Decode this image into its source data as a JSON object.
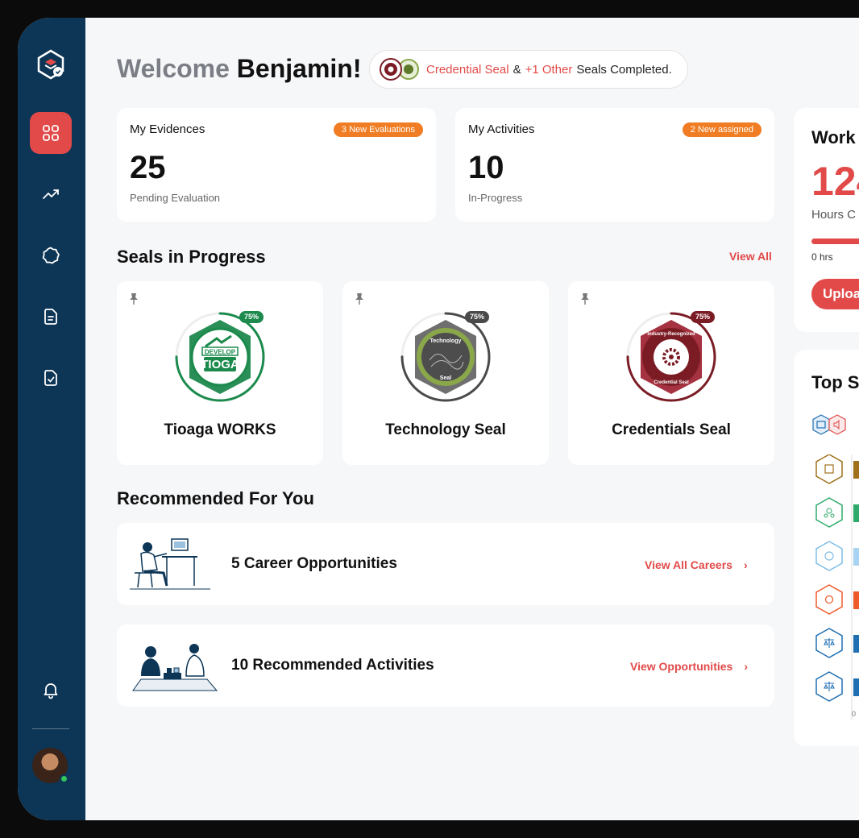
{
  "header": {
    "welcome_prefix": "Welcome",
    "user_name": "Benjamin!",
    "pill": {
      "seal_name": "Credential Seal",
      "connector": "&",
      "others": "+1 Other",
      "suffix": "Seals Completed."
    }
  },
  "sidebar": {
    "items": [
      {
        "icon": "dashboard-grid-icon",
        "active": true
      },
      {
        "icon": "trending-up-icon",
        "active": false
      },
      {
        "icon": "seal-icon",
        "active": false
      },
      {
        "icon": "document-icon",
        "active": false
      },
      {
        "icon": "checklist-icon",
        "active": false
      }
    ],
    "notification_icon": "bell-icon"
  },
  "stats": [
    {
      "title": "My Evidences",
      "badge": "3 New Evaluations",
      "value": "25",
      "subtitle": "Pending Evaluation"
    },
    {
      "title": "My Activities",
      "badge": "2 New assigned",
      "value": "10",
      "subtitle": "In-Progress"
    }
  ],
  "seals_section": {
    "title": "Seals in Progress",
    "view_all": "View All",
    "seals": [
      {
        "name": "Tioaga WORKS",
        "percent": "75%",
        "progress": 0.75,
        "color": "#1b8a4c",
        "badge_text_top": "DEVELOP",
        "badge_text_main": "TIOGA"
      },
      {
        "name": "Technology Seal",
        "percent": "75%",
        "progress": 0.75,
        "color": "#4a4a4a",
        "badge_text_top": "Technology",
        "badge_text_main": "Seal"
      },
      {
        "name": "Credentials Seal",
        "percent": "75%",
        "progress": 0.75,
        "color": "#7b1c25",
        "badge_text_top": "Industry-Recognized",
        "badge_text_main": "Credential Seal"
      }
    ]
  },
  "recommended": {
    "title": "Recommended For You",
    "items": [
      {
        "title": "5 Career Opportunities",
        "link": "View All Careers",
        "chevron": "›"
      },
      {
        "title": "10 Recommended Activities",
        "link": "View Opportunities",
        "chevron": "›"
      }
    ]
  },
  "work_card": {
    "title": "Work",
    "value": "124",
    "subtitle": "Hours C",
    "hours_label": "0 hrs",
    "button": "Uploa"
  },
  "top_skills": {
    "title": "Top S",
    "axis_label": "0",
    "colors": [
      "#a0701a",
      "#2faa6a",
      "#7fbfe8",
      "#ee5a2a",
      "#1f6fb3",
      "#1f6fb3"
    ]
  },
  "colors": {
    "accent": "#e14a49",
    "sidebar": "#0c3556",
    "badge": "#f07d23"
  }
}
